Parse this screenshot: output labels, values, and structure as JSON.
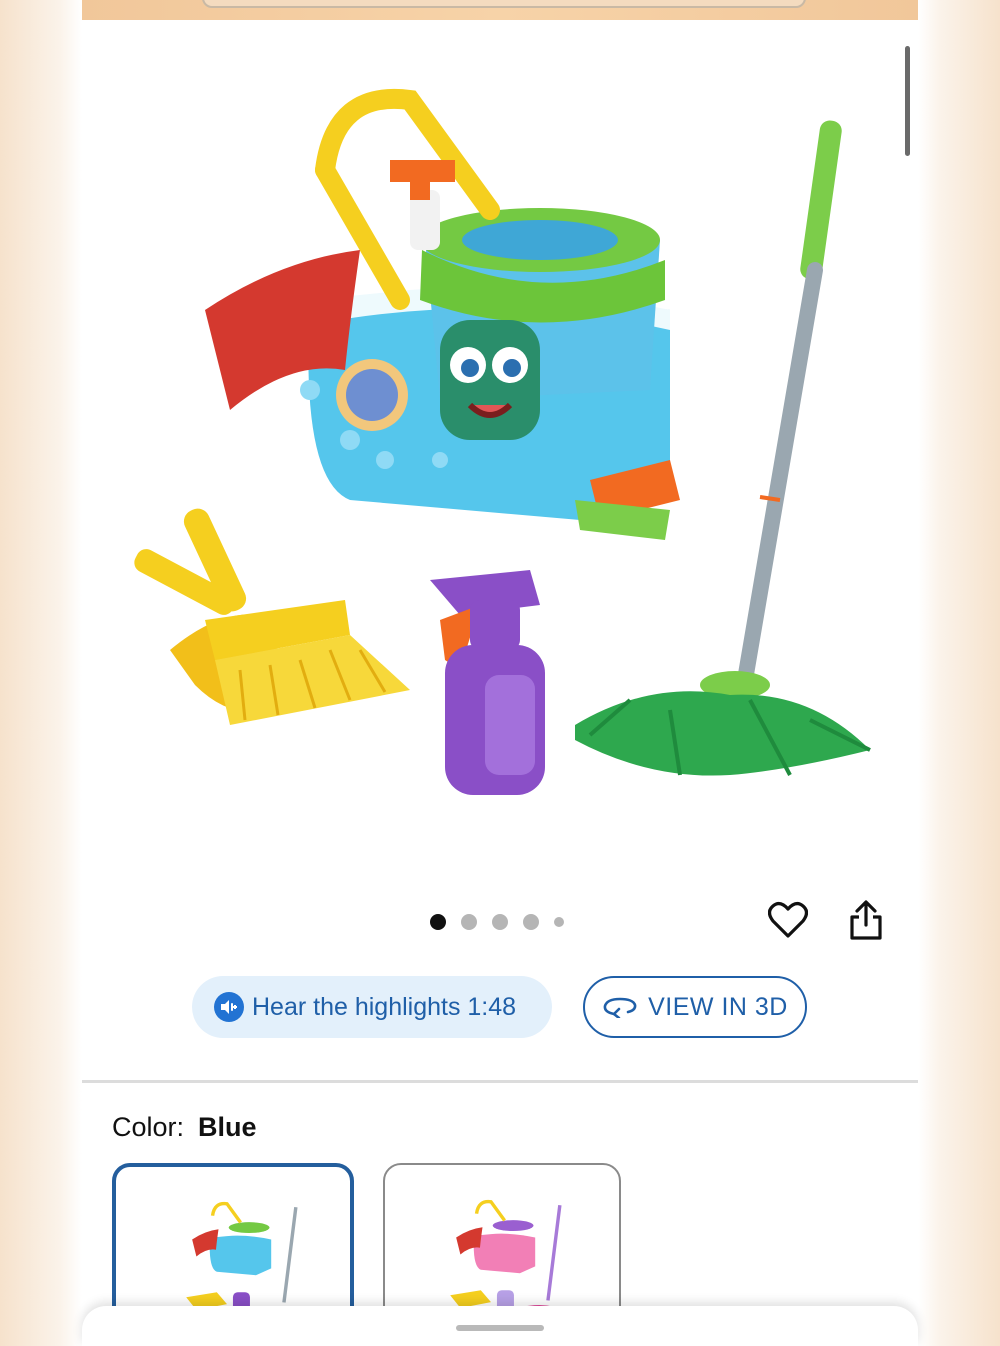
{
  "gallery": {
    "dots": [
      {
        "active": true
      },
      {
        "active": false
      },
      {
        "active": false
      },
      {
        "active": false
      },
      {
        "active": false,
        "small": true
      }
    ],
    "favorite_icon": "heart-outline-icon",
    "share_icon": "share-icon"
  },
  "media_actions": {
    "audio_label": "Hear the highlights 1:48",
    "audio_icon": "speaker-icon",
    "view3d_label": "VIEW IN 3D",
    "view3d_icon": "rotate-3d-icon"
  },
  "variant": {
    "label": "Color:",
    "selected_value": "Blue",
    "options": [
      {
        "name": "Blue",
        "selected": true
      },
      {
        "name": "Pink",
        "selected": false
      }
    ]
  },
  "colors": {
    "accent_blue": "#1f5fa8",
    "selected_border": "#245e9d",
    "pill_bg": "#e3f0fb"
  }
}
